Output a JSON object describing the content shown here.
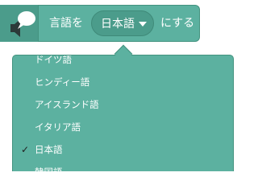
{
  "block": {
    "icon": "speech-bubble-icon",
    "prefix_label": "言語を",
    "selected_language": "日本語",
    "suffix_label": "にする"
  },
  "dropdown": {
    "items": [
      {
        "label": "ドイツ語",
        "checked": false
      },
      {
        "label": "ヒンディー語",
        "checked": false
      },
      {
        "label": "アイスランド語",
        "checked": false
      },
      {
        "label": "イタリア語",
        "checked": false
      },
      {
        "label": "日本語",
        "checked": true
      },
      {
        "label": "韓国語",
        "checked": false
      }
    ],
    "check_mark": "✓"
  },
  "colors": {
    "block": "#5cb1a0",
    "block_border": "#43937f",
    "pill": "#4b9c8b",
    "text": "#ffffff",
    "check": "#1f1f1f"
  }
}
